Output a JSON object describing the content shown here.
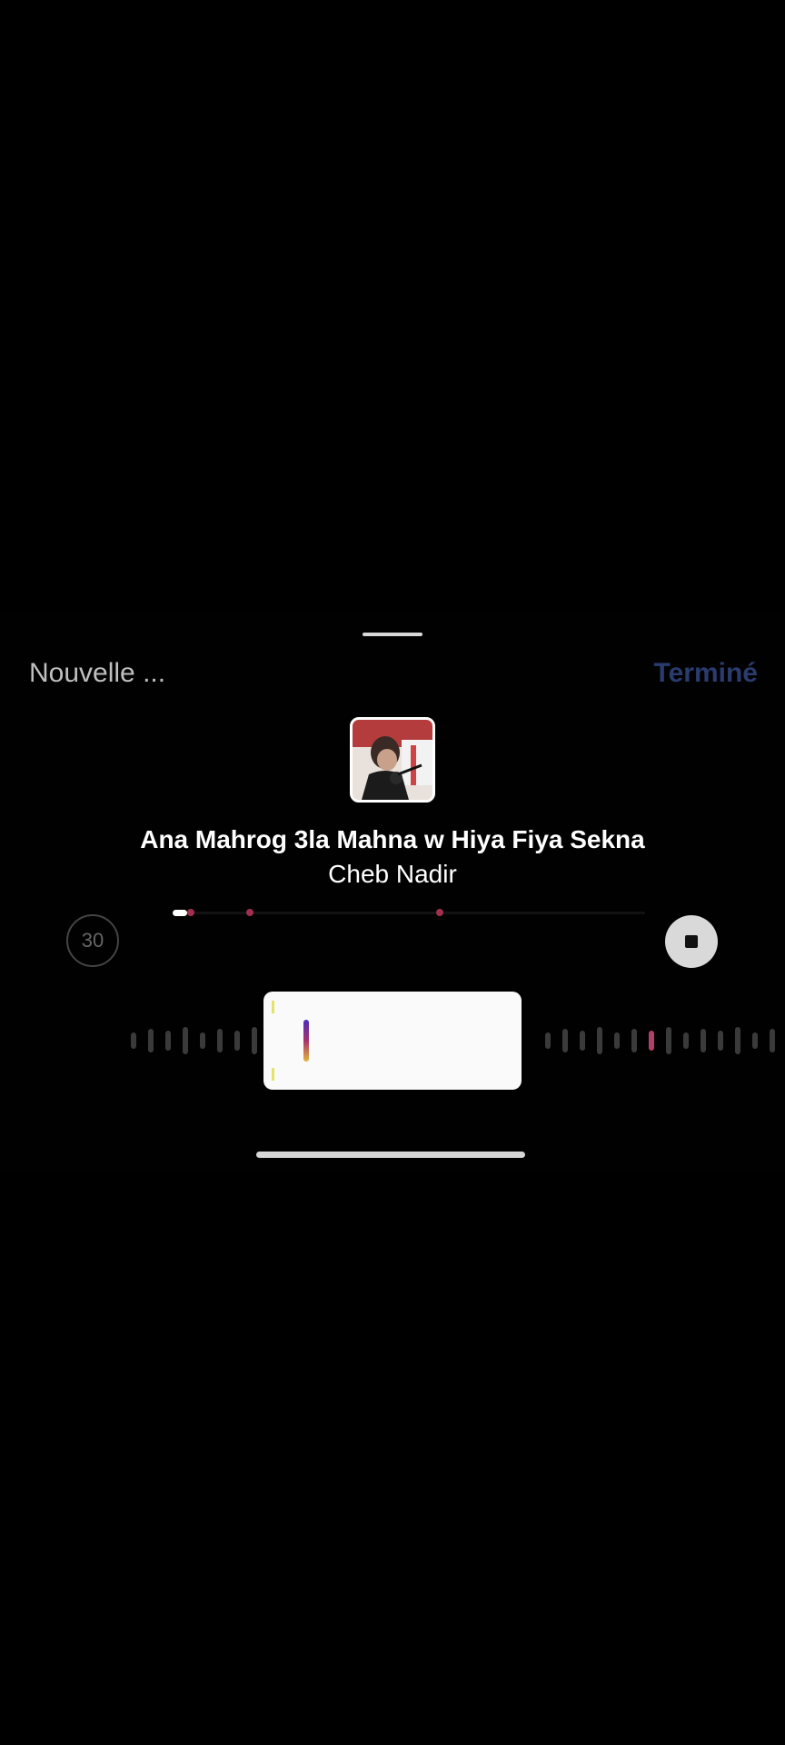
{
  "header": {
    "left_label": "Nouvelle ...",
    "right_label": "Terminé"
  },
  "track": {
    "title": "Ana Mahrog 3la Mahna w Hiya Fiya Sekna",
    "artist": "Cheb Nadir",
    "progress_fraction": 0.03
  },
  "controls": {
    "duration_badge": "30",
    "stop_icon": "stop-icon"
  },
  "colors": {
    "accent_dot": "#a0304e",
    "done_label": "#2a3b6e"
  }
}
